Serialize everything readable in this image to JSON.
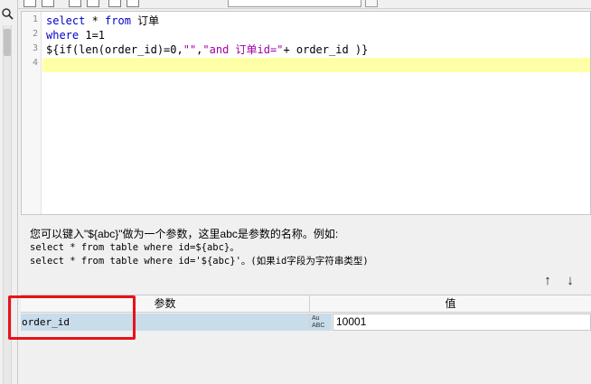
{
  "editor": {
    "line_numbers": [
      "1",
      "2",
      "3",
      "4"
    ],
    "line1": {
      "kw1": "select",
      "op": " * ",
      "kw2": "from",
      "rest": " 订单"
    },
    "line2": {
      "kw": "where",
      "rest": " 1=1"
    },
    "line3": {
      "a": "${if(len(order_id)=0,",
      "b": "\"\"",
      "c": ",",
      "d": "\"and 订单id=\"",
      "e": "+ order_id )}"
    },
    "line4": ""
  },
  "hint": {
    "line1": "您可以键入\"${abc}\"做为一个参数，这里abc是参数的名称。例如:",
    "line2": "select * from table where id=${abc}。",
    "line3": "select * from table where id='${abc}'。(如果id字段为字符串类型)"
  },
  "buttons": {
    "up": "↑",
    "down": "↓"
  },
  "param_table": {
    "header_param": "参数",
    "header_value": "值",
    "rows": [
      {
        "name": "order_id",
        "type_icon": "Au ABC",
        "value": "10001"
      }
    ]
  },
  "colors": {
    "highlight": "#e8121a",
    "selected_row": "#c8dcea",
    "current_line": "#ffffa8",
    "keyword": "#0000cc",
    "string": "#a000a0"
  }
}
